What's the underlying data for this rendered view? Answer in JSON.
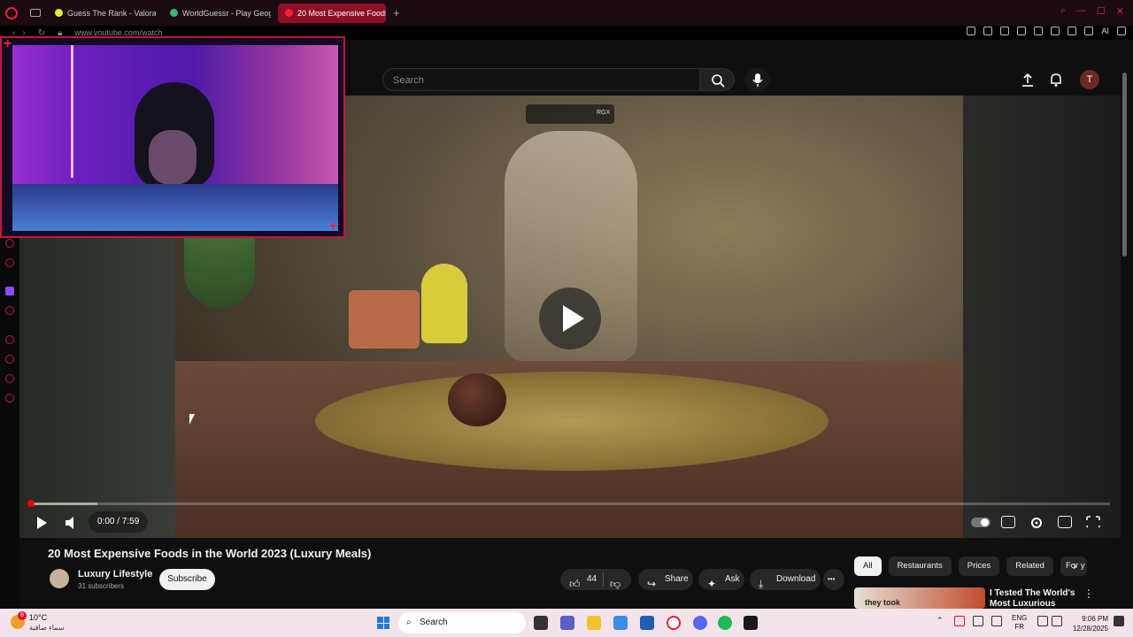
{
  "browser": {
    "tabs": [
      {
        "label": "Guess The Rank - Valorant",
        "favicon_color": "#e8e83a",
        "active": false
      },
      {
        "label": "WorldGuessr - Play Geography",
        "favicon_color": "#3ab86a",
        "active": false
      },
      {
        "label": "20 Most Expensive Foods",
        "favicon_color": "#ff2030",
        "active": true
      }
    ],
    "new_tab": "+",
    "url": "www.youtube.com/watch",
    "toolbar_ai_label": "AI",
    "accent": "#e0263b"
  },
  "youtube": {
    "search_placeholder": "Search",
    "avatar_letter": "T",
    "player": {
      "time": "0:00 / 7:59",
      "progress_fraction": 0.0,
      "mini_label": "RGX"
    },
    "video": {
      "title": "20 Most Expensive Foods in the World 2023 (Luxury Meals)",
      "channel": "Luxury Lifestyle",
      "subscribers": "31 subscribers",
      "subscribe_label": "Subscribe",
      "likes": "44",
      "share_label": "Share",
      "ask_label": "Ask",
      "download_label": "Download",
      "more_label": "•••"
    },
    "chips": [
      "All",
      "Restaurants",
      "Prices",
      "Related",
      "For y"
    ],
    "recommendation": {
      "title": "I Tested The World's Most Luxurious",
      "thumb_text": "they took"
    }
  },
  "taskbar": {
    "weather_badge": "8",
    "temperature": "10°C",
    "condition": "سماء صافية",
    "search_label": "Search",
    "lang_line1": "ENG",
    "lang_line2": "FR",
    "time": "9:06 PM",
    "date": "12/28/2025"
  }
}
